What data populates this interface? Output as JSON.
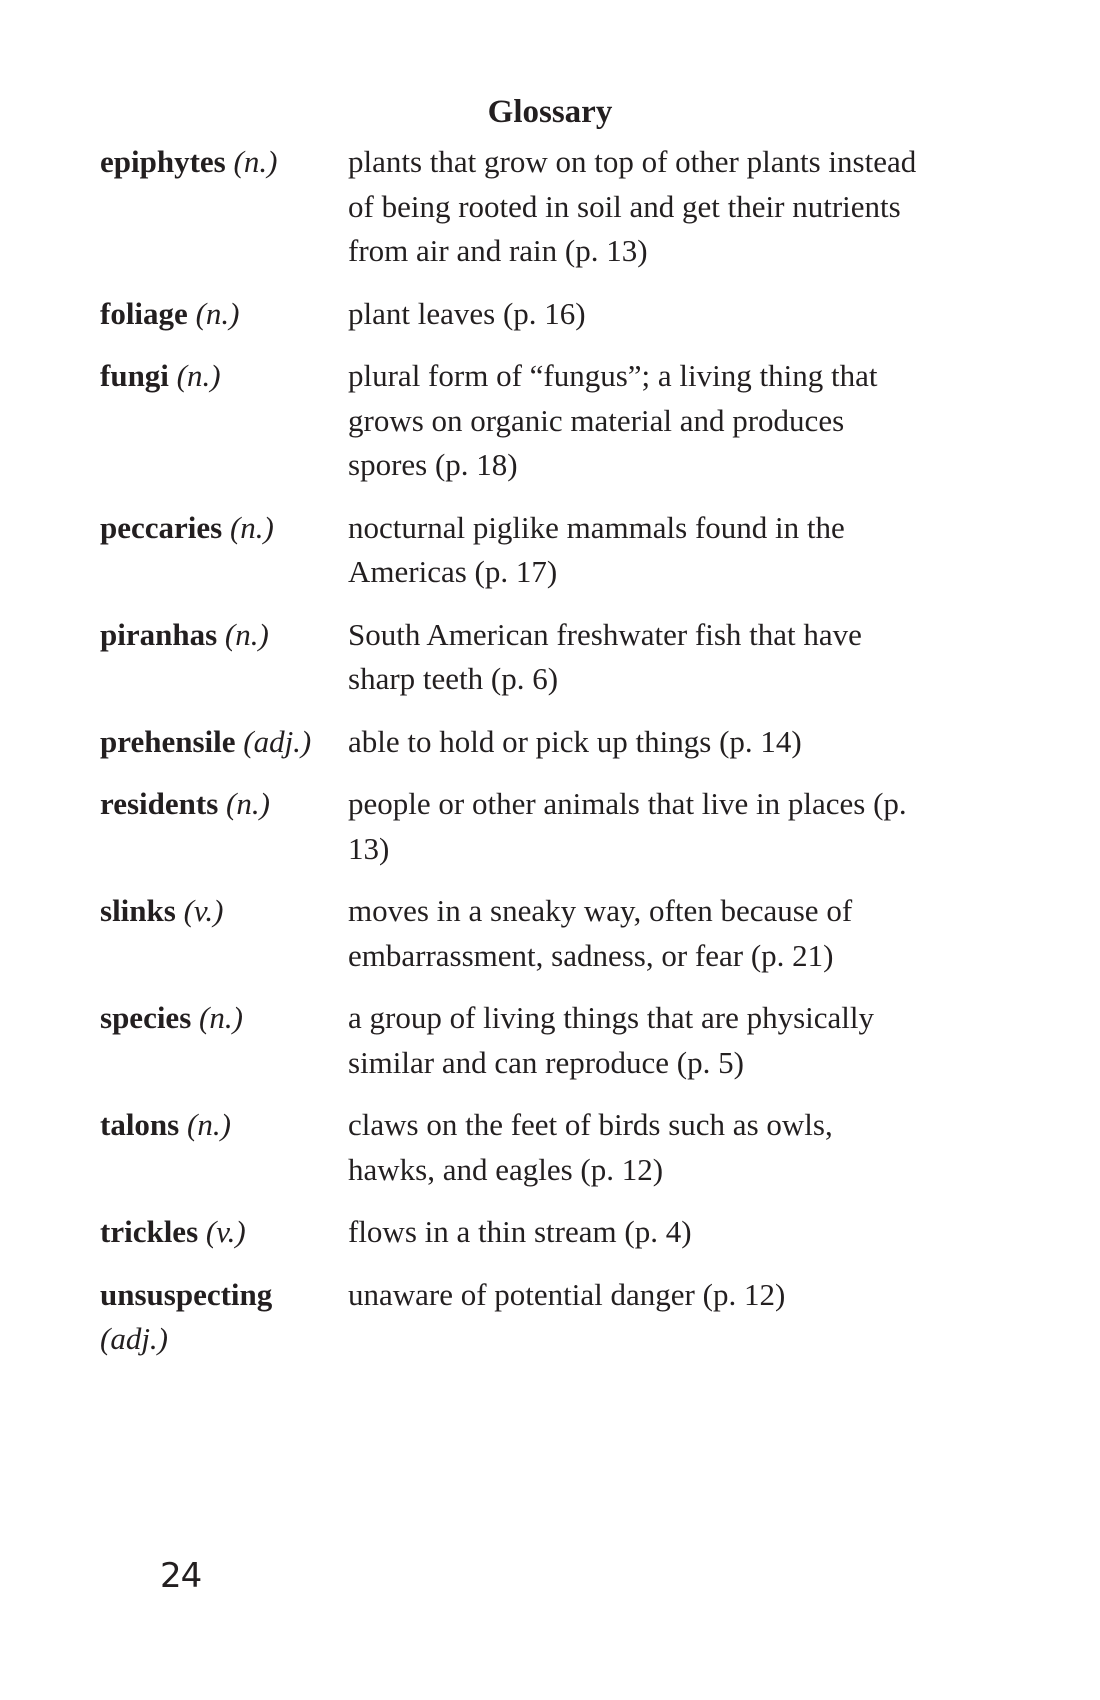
{
  "page": {
    "title": "Glossary",
    "page_number": "24"
  },
  "entries": [
    {
      "term": "epiphytes",
      "pos": "(n.)",
      "definition": "plants that grow on top of other plants instead of being rooted in soil and get their nutrients from air and rain (p. 13)"
    },
    {
      "term": "foliage",
      "pos": "(n.)",
      "definition": "plant leaves (p. 16)"
    },
    {
      "term": "fungi",
      "pos": "(n.)",
      "definition": "plural form of “fungus”; a living thing that grows on organic material and produces spores (p. 18)"
    },
    {
      "term": "peccaries",
      "pos": "(n.)",
      "definition": "nocturnal piglike mammals found in the Americas (p. 17)"
    },
    {
      "term": "piranhas",
      "pos": "(n.)",
      "definition": "South American freshwater fish that have sharp teeth (p. 6)"
    },
    {
      "term": "prehensile",
      "pos": "(adj.)",
      "definition": "able to hold or pick up things (p. 14)"
    },
    {
      "term": "residents",
      "pos": "(n.)",
      "definition": "people or other animals that live in places (p. 13)"
    },
    {
      "term": "slinks",
      "pos": "(v.)",
      "definition": "moves in a sneaky way, often because of embarrassment, sadness, or fear (p. 21)"
    },
    {
      "term": "species",
      "pos": "(n.)",
      "definition": "a group of living things that are physically similar and can reproduce (p. 5)"
    },
    {
      "term": "talons",
      "pos": "(n.)",
      "definition": "claws on the feet of birds such as owls, hawks, and eagles (p. 12)"
    },
    {
      "term": "trickles",
      "pos": "(v.)",
      "definition": "flows in a thin stream (p. 4)"
    },
    {
      "term": "unsuspecting",
      "pos": "(adj.)",
      "definition": "unaware of potential danger (p. 12)"
    }
  ]
}
